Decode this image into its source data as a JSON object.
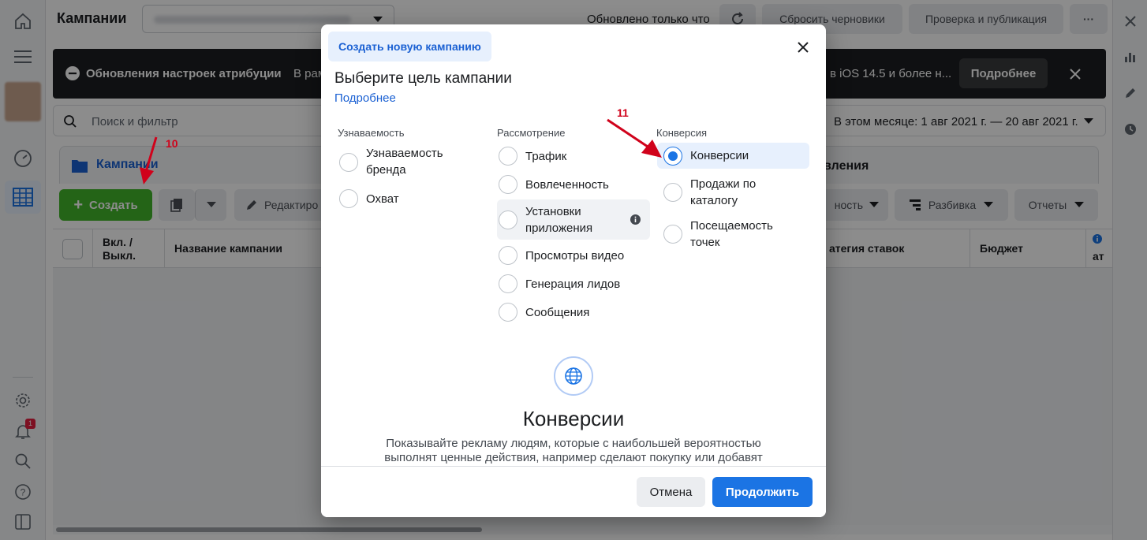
{
  "header": {
    "title": "Кампании",
    "updated": "Обновлено только что",
    "reset_drafts": "Сбросить черновики",
    "review_publish": "Проверка и публикация",
    "more": "···"
  },
  "banner": {
    "title": "Обновления настроек атрибуции",
    "text_prefix": "В рам",
    "text_suffix": "в iOS 14.5 и более н...",
    "more_btn": "Подробнее"
  },
  "search": {
    "placeholder": "Поиск и фильтр",
    "date_range": "В этом месяце: 1 авг 2021 г. — 20 авг 2021 г."
  },
  "tabs": {
    "campaigns": "Кампании",
    "ads_partial": "вления"
  },
  "toolbar": {
    "create": "Создать",
    "edit": "Редактиро",
    "performance_partial": "ность",
    "breakdown": "Разбивка",
    "reports": "Отчеты"
  },
  "table": {
    "col_onoff": "Вкл. / Выкл.",
    "col_name": "Название кампании",
    "col_bid": "атегия ставок",
    "col_budget": "Бюджет",
    "col_attr_partial": "ат"
  },
  "left_nav": {
    "badge": "1"
  },
  "modal": {
    "tab": "Создать новую кампанию",
    "title": "Выберите цель кампании",
    "learn_more": "Подробнее",
    "columns": [
      {
        "header": "Узнаваемость",
        "options": [
          "Узнаваемость бренда",
          "Охват"
        ]
      },
      {
        "header": "Рассмотрение",
        "options": [
          "Трафик",
          "Вовлеченность",
          "Установки приложения",
          "Просмотры видео",
          "Генерация лидов",
          "Сообщения"
        ]
      },
      {
        "header": "Конверсия",
        "options": [
          "Конверсии",
          "Продажи по каталогу",
          "Посещаемость точек"
        ]
      }
    ],
    "selected": "Конверсии",
    "detail_title": "Конверсии",
    "detail_text": "Показывайте рекламу людям, которые с наибольшей вероятностью выполнят ценные действия, например сделают покупку или добавят",
    "cancel": "Отмена",
    "continue": "Продолжить"
  },
  "annotations": {
    "step10": "10",
    "step11": "11"
  },
  "colors": {
    "accent": "#1b74e4",
    "create_green": "#42b72a",
    "annotation_red": "#d0021b"
  }
}
